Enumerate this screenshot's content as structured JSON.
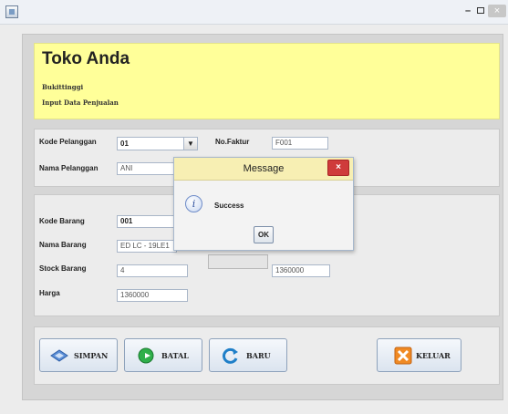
{
  "window": {
    "minimize": "–",
    "close": "×"
  },
  "header": {
    "title": "Toko Anda",
    "subtitle": "Bukittinggi",
    "caption": "Input Data Penjualan"
  },
  "customer": {
    "kode_label": "Kode Pelanggan",
    "kode_value": "01",
    "nofaktur_label": "No.Faktur",
    "nofaktur_value": "F001",
    "nama_label": "Nama Pelanggan",
    "nama_value": "ANI"
  },
  "item": {
    "kode_label": "Kode Barang",
    "kode_value": "001",
    "nama_label": "Nama Barang",
    "nama_value": "ED LC - 19LE1",
    "stock_label": "Stock Barang",
    "stock_value": "4",
    "harga_label": "Harga",
    "harga_value": "1360000",
    "total_value": "1360000"
  },
  "buttons": {
    "simpan": "SIMPAN",
    "batal": "BATAL",
    "baru": "BARU",
    "keluar": "KELUAR"
  },
  "dialog": {
    "title": "Message",
    "message": "Success",
    "ok": "OK",
    "close": "×"
  },
  "colors": {
    "header_bg": "#ffff99",
    "dialog_bar": "#f7efb3",
    "close_red": "#cf3b3b"
  },
  "icons": [
    "app-icon",
    "info-icon",
    "save-icon",
    "cancel-icon",
    "refresh-icon",
    "exit-icon",
    "dropdown-arrow-icon"
  ]
}
